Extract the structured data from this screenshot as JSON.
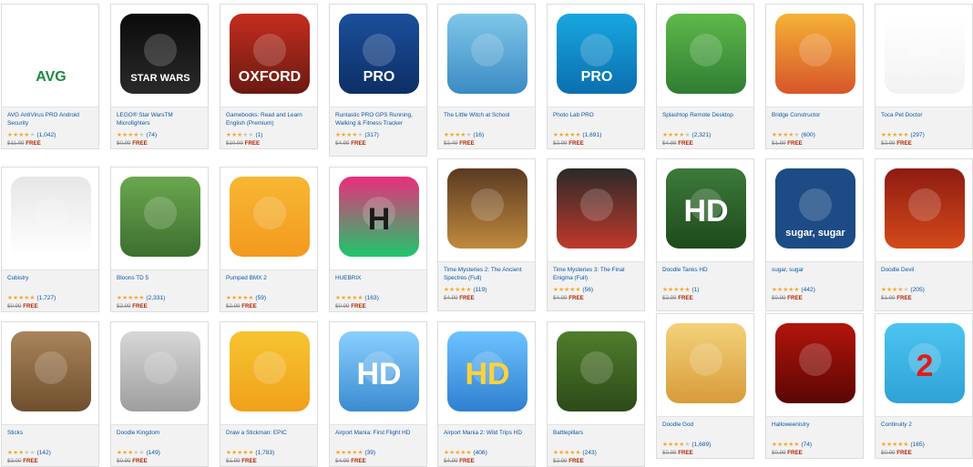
{
  "apps": [
    {
      "id": "avg",
      "title": "AVG AntiVirus PRO Android Security",
      "rating": 3.5,
      "count": "(1,042)",
      "old_price": "$11.99",
      "price": "FREE",
      "icon": "avg-shield-icon",
      "colors": [
        "#ffffff",
        "#ffffff"
      ],
      "glyph": "AVG",
      "glyph_color": "#1c8c3c"
    },
    {
      "id": "lego",
      "title": "LEGO® Star WarsTM Microfighters",
      "rating": 3.5,
      "count": "(74)",
      "old_price": "$0.99",
      "price": "FREE",
      "icon": "lego-star-wars-icon",
      "colors": [
        "#0b0b0b",
        "#2a2a2a"
      ],
      "glyph": "STAR WARS",
      "glyph_color": "#ffffff"
    },
    {
      "id": "gamebooks",
      "title": "Gamebooks: Read and Learn English (Premium)",
      "rating": 3,
      "count": "(1)",
      "old_price": "$10.99",
      "price": "FREE",
      "icon": "oxford-gamebooks-icon",
      "colors": [
        "#c42d1e",
        "#6a1a12"
      ],
      "glyph": "OXFORD",
      "glyph_color": "#ffffff"
    },
    {
      "id": "runtastic",
      "title": "Runtastic PRO GPS Running, Walking & Fitness Tracker",
      "rating": 4,
      "count": "(317)",
      "old_price": "$4.99",
      "price": "FREE",
      "icon": "runtastic-runner-icon",
      "colors": [
        "#1b4f9c",
        "#0d2f66"
      ],
      "glyph": "PRO",
      "glyph_color": "#ffffff"
    },
    {
      "id": "witch",
      "title": "The Little Witch at School",
      "rating": 4,
      "count": "(16)",
      "old_price": "$2.49",
      "price": "FREE",
      "icon": "little-witch-icon",
      "colors": [
        "#7fc6e8",
        "#3b8bc4"
      ],
      "glyph": "",
      "glyph_color": "#ffffff"
    },
    {
      "id": "photolab",
      "title": "Photo Lab PRO",
      "rating": 4.5,
      "count": "(1,691)",
      "old_price": "$2.99",
      "price": "FREE",
      "icon": "photo-lab-flask-icon",
      "colors": [
        "#18a7e0",
        "#0b6fb0"
      ],
      "glyph": "PRO",
      "glyph_color": "#ffffff"
    },
    {
      "id": "splashtop",
      "title": "Splashtop Remote Desktop",
      "rating": 4,
      "count": "(2,321)",
      "old_price": "$4.99",
      "price": "FREE",
      "icon": "splashtop-remote-icon",
      "colors": [
        "#5fb94a",
        "#2f7d33"
      ],
      "glyph": "",
      "glyph_color": "#ffffff"
    },
    {
      "id": "bridge",
      "title": "Bridge Constructor",
      "rating": 4,
      "count": "(600)",
      "old_price": "$1.99",
      "price": "FREE",
      "icon": "bridge-constructor-icon",
      "colors": [
        "#f5b236",
        "#d7552a"
      ],
      "glyph": "",
      "glyph_color": "#ffffff"
    },
    {
      "id": "toca",
      "title": "Toca Pet Doctor",
      "rating": 4.5,
      "count": "(297)",
      "old_price": "$2.99",
      "price": "FREE",
      "icon": "toca-pet-doctor-icon",
      "colors": [
        "#ffffff",
        "#f2f2f2"
      ],
      "glyph": "",
      "glyph_color": "#000000"
    },
    {
      "id": "cubistry",
      "title": "Cubistry",
      "rating": 4.5,
      "count": "(1,727)",
      "old_price": "$0.99",
      "price": "FREE",
      "icon": "cubistry-cube-icon",
      "colors": [
        "#e6e6e6",
        "#ffffff"
      ],
      "glyph": "",
      "glyph_color": "#000000"
    },
    {
      "id": "bloons",
      "title": "Bloons TD 5",
      "rating": 4.5,
      "count": "(2,331)",
      "old_price": "$2.99",
      "price": "FREE",
      "icon": "bloons-monkey-icon",
      "colors": [
        "#6aa84f",
        "#3d6e2f"
      ],
      "glyph": "",
      "glyph_color": "#ffffff"
    },
    {
      "id": "bmx",
      "title": "Pumped BMX 2",
      "rating": 4.5,
      "count": "(59)",
      "old_price": "$2.99",
      "price": "FREE",
      "icon": "pumped-bmx-icon",
      "colors": [
        "#f7b733",
        "#f39a1e"
      ],
      "glyph": "",
      "glyph_color": "#ffffff"
    },
    {
      "id": "huebrix",
      "title": "HUEBRIX",
      "rating": 4.5,
      "count": "(163)",
      "old_price": "$0.99",
      "price": "FREE",
      "icon": "huebrix-h-icon",
      "colors": [
        "#ea2d7c",
        "#1ec76b"
      ],
      "glyph": "H",
      "glyph_color": "#1a1a1a"
    },
    {
      "id": "tm2",
      "title": "Time Mysteries 2: The Ancient Spectres (Full)",
      "rating": 4.5,
      "count": "(119)",
      "old_price": "$4.99",
      "price": "FREE",
      "icon": "time-mysteries-2-icon",
      "colors": [
        "#5a3a22",
        "#c08a3e"
      ],
      "glyph": "",
      "glyph_color": "#ffffff"
    },
    {
      "id": "tm3",
      "title": "Time Mysteries 3: The Final Enigma (Full)",
      "rating": 4.5,
      "count": "(56)",
      "old_price": "$4.99",
      "price": "FREE",
      "icon": "time-mysteries-3-icon",
      "colors": [
        "#2a2a2a",
        "#c0392b"
      ],
      "glyph": "",
      "glyph_color": "#ffffff"
    },
    {
      "id": "doodletanks",
      "title": "Doodle Tanks HD",
      "rating": 4.5,
      "count": "(1)",
      "old_price": "$2.99",
      "price": "FREE",
      "icon": "doodle-tanks-icon",
      "colors": [
        "#3c7a3a",
        "#1e4a1c"
      ],
      "glyph": "HD",
      "glyph_color": "#ffffff"
    },
    {
      "id": "sugar",
      "title": "sugar, sugar",
      "rating": 4.5,
      "count": "(442)",
      "old_price": "$0.99",
      "price": "FREE",
      "icon": "sugar-sugar-icon",
      "colors": [
        "#1d4b86",
        "#1d4b86"
      ],
      "glyph": "sugar, sugar",
      "glyph_color": "#ffffff"
    },
    {
      "id": "doodledevil",
      "title": "Doodle Devil",
      "rating": 3.5,
      "count": "(205)",
      "old_price": "$1.99",
      "price": "FREE",
      "icon": "doodle-devil-eye-icon",
      "colors": [
        "#8e1b12",
        "#d44a1a"
      ],
      "glyph": "",
      "glyph_color": "#ffffff"
    },
    {
      "id": "sticks",
      "title": "Sticks",
      "rating": 3,
      "count": "(142)",
      "old_price": "$3.00",
      "price": "FREE",
      "icon": "sticks-game-icon",
      "colors": [
        "#a9845b",
        "#6f4f2e"
      ],
      "glyph": "",
      "glyph_color": "#ffffff"
    },
    {
      "id": "doodlekingdom",
      "title": "Doodle Kingdom",
      "rating": 3,
      "count": "(149)",
      "old_price": "$0.99",
      "price": "FREE",
      "icon": "doodle-kingdom-dragon-icon",
      "colors": [
        "#d7d7d7",
        "#9e9e9e"
      ],
      "glyph": "",
      "glyph_color": "#ffffff"
    },
    {
      "id": "drawstickman",
      "title": "Draw a Stickman: EPIC",
      "rating": 4.5,
      "count": "(1,783)",
      "old_price": "$1.99",
      "price": "FREE",
      "icon": "draw-stickman-icon",
      "colors": [
        "#f6c431",
        "#f0a11a"
      ],
      "glyph": "",
      "glyph_color": "#ffffff"
    },
    {
      "id": "airport1",
      "title": "Airport Mania: First Flight HD",
      "rating": 4.5,
      "count": "(39)",
      "old_price": "$4.99",
      "price": "FREE",
      "icon": "airport-mania-1-icon",
      "colors": [
        "#8ad0ff",
        "#3b8bd0"
      ],
      "glyph": "HD",
      "glyph_color": "#ffffff"
    },
    {
      "id": "airport2",
      "title": "Airport Mania 2: Wild Trips HD",
      "rating": 4.5,
      "count": "(406)",
      "old_price": "$4.99",
      "price": "FREE",
      "icon": "airport-mania-2-icon",
      "colors": [
        "#6cc3ff",
        "#2f7fd0"
      ],
      "glyph": "HD",
      "glyph_color": "#ffd23a"
    },
    {
      "id": "battlepillars",
      "title": "Battlepillars",
      "rating": 4.5,
      "count": "(243)",
      "old_price": "$2.99",
      "price": "FREE",
      "icon": "battlepillars-icon",
      "colors": [
        "#4f7d2c",
        "#2d4a18"
      ],
      "glyph": "",
      "glyph_color": "#ffffff"
    },
    {
      "id": "doodlegod",
      "title": "Doodle God",
      "rating": 3.5,
      "count": "(1,689)",
      "old_price": "$0.99",
      "price": "FREE",
      "icon": "doodle-god-eye-icon",
      "colors": [
        "#f3d27a",
        "#d89b3a"
      ],
      "glyph": "",
      "glyph_color": "#ffffff"
    },
    {
      "id": "halloween",
      "title": "Halloweenistry",
      "rating": 4.5,
      "count": "(74)",
      "old_price": "$0.99",
      "price": "FREE",
      "icon": "halloween-pumpkin-icon",
      "colors": [
        "#b3150c",
        "#5a0604"
      ],
      "glyph": "",
      "glyph_color": "#ffffff"
    },
    {
      "id": "continuity",
      "title": "Continuity 2",
      "rating": 4.5,
      "count": "(165)",
      "old_price": "$0.99",
      "price": "FREE",
      "icon": "continuity-2-icon",
      "colors": [
        "#4cc4f0",
        "#2fa2d6"
      ],
      "glyph": "2",
      "glyph_color": "#e21b1b"
    }
  ]
}
